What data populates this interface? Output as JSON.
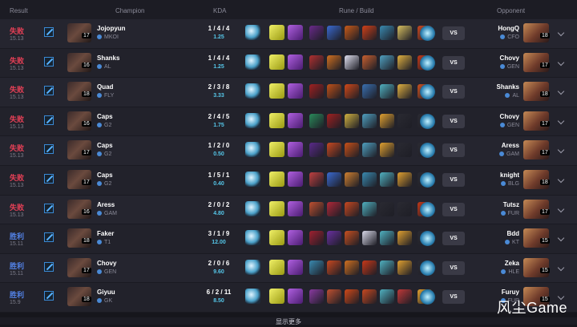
{
  "header": {
    "result": "Result",
    "champion": "Champion",
    "kda": "KDA",
    "rune_build": "Rune / Build",
    "opponent": "Opponent"
  },
  "colors": {
    "lose": "#e84057",
    "win": "#5383e8",
    "ratio": "#55c6e8"
  },
  "matches": [
    {
      "result": "失败",
      "outcome": "lose",
      "patch": "15.13",
      "level": "17",
      "player": "Jojopyun",
      "team": "MKOI",
      "kda": "1 / 4 / 4",
      "ratio": "1.25",
      "opponent": "HongQ",
      "opp_team": "CFO",
      "opp_level": "18",
      "items": [
        "#6a2a8a",
        "#3a6ad0",
        "#c85a18",
        "#d04018",
        "#3a8ab0",
        "#d8c060",
        "#c84820"
      ]
    },
    {
      "result": "失败",
      "outcome": "lose",
      "patch": "15.13",
      "level": "16",
      "player": "Shanks",
      "team": "AL",
      "kda": "1 / 4 / 4",
      "ratio": "1.25",
      "opponent": "Chovy",
      "opp_team": "GEN",
      "opp_level": "17",
      "items": [
        "#b03030",
        "#d07020",
        "#e0e0f0",
        "#c86030",
        "#50a0c0",
        "#e0b040",
        "#c03818"
      ]
    },
    {
      "result": "失败",
      "outcome": "lose",
      "patch": "15.13",
      "level": "18",
      "player": "Quad",
      "team": "FLY",
      "kda": "2 / 3 / 8",
      "ratio": "3.33",
      "opponent": "Shanks",
      "opp_team": "AL",
      "opp_level": "18",
      "items": [
        "#a02020",
        "#c05018",
        "#d04818",
        "#3a70b0",
        "#50b0c0",
        "#e0b040",
        "#c85020"
      ]
    },
    {
      "result": "失败",
      "outcome": "lose",
      "patch": "15.13",
      "level": "16",
      "player": "Caps",
      "team": "G2",
      "kda": "2 / 4 / 5",
      "ratio": "1.75",
      "opponent": "Chovy",
      "opp_team": "GEN",
      "opp_level": "17",
      "items": [
        "#2a8a5a",
        "#a02020",
        "#d0b040",
        "#50a0c0",
        "#e0a030",
        "#2a2a32",
        "#2a2a32"
      ]
    },
    {
      "result": "失败",
      "outcome": "lose",
      "patch": "15.13",
      "level": "17",
      "player": "Caps",
      "team": "G2",
      "kda": "1 / 2 / 0",
      "ratio": "0.50",
      "opponent": "Aress",
      "opp_team": "GAM",
      "opp_level": "17",
      "items": [
        "#5a2a8a",
        "#c84820",
        "#c85018",
        "#50a0c0",
        "#e0a030",
        "#2a2a32",
        "#2a2a32"
      ]
    },
    {
      "result": "失败",
      "outcome": "lose",
      "patch": "15.13",
      "level": "17",
      "player": "Caps",
      "team": "G2",
      "kda": "1 / 5 / 1",
      "ratio": "0.40",
      "opponent": "knight",
      "opp_team": "BLG",
      "opp_level": "18",
      "items": [
        "#c04040",
        "#3a6ad0",
        "#d08030",
        "#3a8ab0",
        "#50b0c0",
        "#e0a030",
        "#2a2a32"
      ]
    },
    {
      "result": "失败",
      "outcome": "lose",
      "patch": "15.13",
      "level": "16",
      "player": "Aress",
      "team": "GAM",
      "kda": "2 / 0 / 2",
      "ratio": "4.80",
      "opponent": "Tutsz",
      "opp_team": "FUR",
      "opp_level": "17",
      "items": [
        "#c05030",
        "#b02838",
        "#c84820",
        "#50b0c0",
        "#2a2a32",
        "#2a2a32",
        "#c03818"
      ]
    },
    {
      "result": "胜利",
      "outcome": "win",
      "patch": "15.11",
      "level": "18",
      "player": "Faker",
      "team": "T1",
      "kda": "3 / 1 / 9",
      "ratio": "12.00",
      "opponent": "Bdd",
      "opp_team": "KT",
      "opp_level": "15",
      "items": [
        "#a02030",
        "#6a30a0",
        "#c85020",
        "#d8d8e8",
        "#50b0c0",
        "#e0a030",
        "#2a2a32"
      ]
    },
    {
      "result": "胜利",
      "outcome": "win",
      "patch": "15.11",
      "level": "17",
      "player": "Chovy",
      "team": "GEN",
      "kda": "2 / 0 / 6",
      "ratio": "9.60",
      "opponent": "Zeka",
      "opp_team": "HLE",
      "opp_level": "15",
      "items": [
        "#3a8ab0",
        "#c84820",
        "#d07020",
        "#c83818",
        "#50b0c0",
        "#e0a030",
        "#2a2a32"
      ]
    },
    {
      "result": "胜利",
      "outcome": "win",
      "patch": "15.9",
      "level": "18",
      "player": "Giyuu",
      "team": "GK",
      "kda": "6 / 2 / 11",
      "ratio": "8.50",
      "opponent": "Furuy",
      "opp_team": "FUR",
      "opp_level": "15",
      "items": [
        "#8a3aa0",
        "#c05030",
        "#d04818",
        "#c84820",
        "#50b0c0",
        "#c03838",
        "#e0a030"
      ]
    }
  ],
  "footer": {
    "show_more": "显示更多"
  },
  "watermark": "风尘Game"
}
